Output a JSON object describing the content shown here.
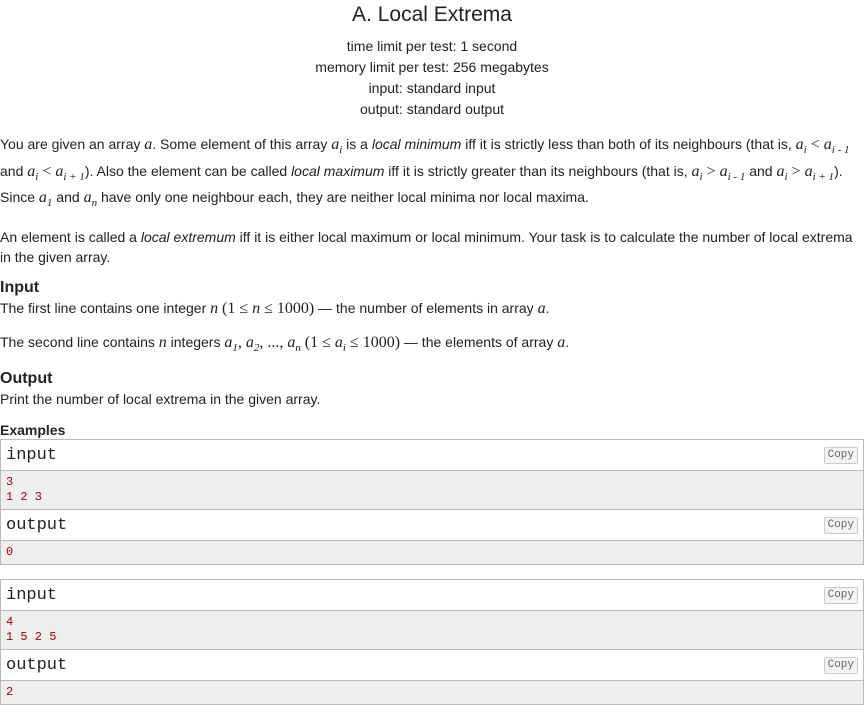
{
  "problem": {
    "title": "A. Local Extrema",
    "limits": [
      "time limit per test: 1 second",
      "memory limit per test: 256 megabytes",
      "input: standard input",
      "output: standard output"
    ],
    "statement": {
      "p1_a": "You are given an array ",
      "p1_b": ". Some element of this array ",
      "p1_c": " is a ",
      "p1_d": "local minimum",
      "p1_e": " iff it is strictly less than both of its neighbours (that is, ",
      "p1_f": " and ",
      "p1_g": "). Also the element can be called ",
      "p1_h": "local maximum",
      "p1_i": " iff it is strictly greater than its neighbours (that is, ",
      "p1_j": " and ",
      "p1_k": ").",
      "p1_l": "Since ",
      "p1_m": " and ",
      "p1_n": " have only one neighbour each, they are neither local minima nor local maxima.",
      "p2_a": "An element is called a ",
      "p2_b": "local extremum",
      "p2_c": " iff it is either local maximum or local minimum. Your task is to calculate the number of local extrema in the given array."
    },
    "input_section": {
      "title": "Input",
      "l1_a": "The first line contains one integer ",
      "l1_b": " — the number of elements in array ",
      "l1_c": ".",
      "l2_a": "The second line contains ",
      "l2_b": " integers ",
      "l2_c": " — the elements of array ",
      "l2_d": "."
    },
    "output_section": {
      "title": "Output",
      "text": "Print the number of local extrema in the given array."
    },
    "examples": {
      "title": "Examples",
      "copy_label": "Copy",
      "input_label": "input",
      "output_label": "output",
      "e1_in_1": "3",
      "e1_in_2": "1 2 3",
      "e1_out_1": "0",
      "e2_in_1": "4",
      "e2_in_2": "1 5 2 5",
      "e2_out_1": "2"
    },
    "math": {
      "a": "a",
      "n": "n",
      "ai_base": "a",
      "ai_sub": "i",
      "ineq_lt": " < ",
      "ineq_gt": " > ",
      "im1": "i - 1",
      "ip1": "i + 1",
      "one": "1",
      "nsub": "n",
      "two": "2",
      "n_range_open": "(1 ≤ ",
      "n_range_mid": " ≤ 1000)",
      "a_list_sep1": ", ",
      "a_list_sep2": ", ..., ",
      "ai_range_open": "(1 ≤ ",
      "ai_range_mid": " ≤ 1000)"
    }
  }
}
